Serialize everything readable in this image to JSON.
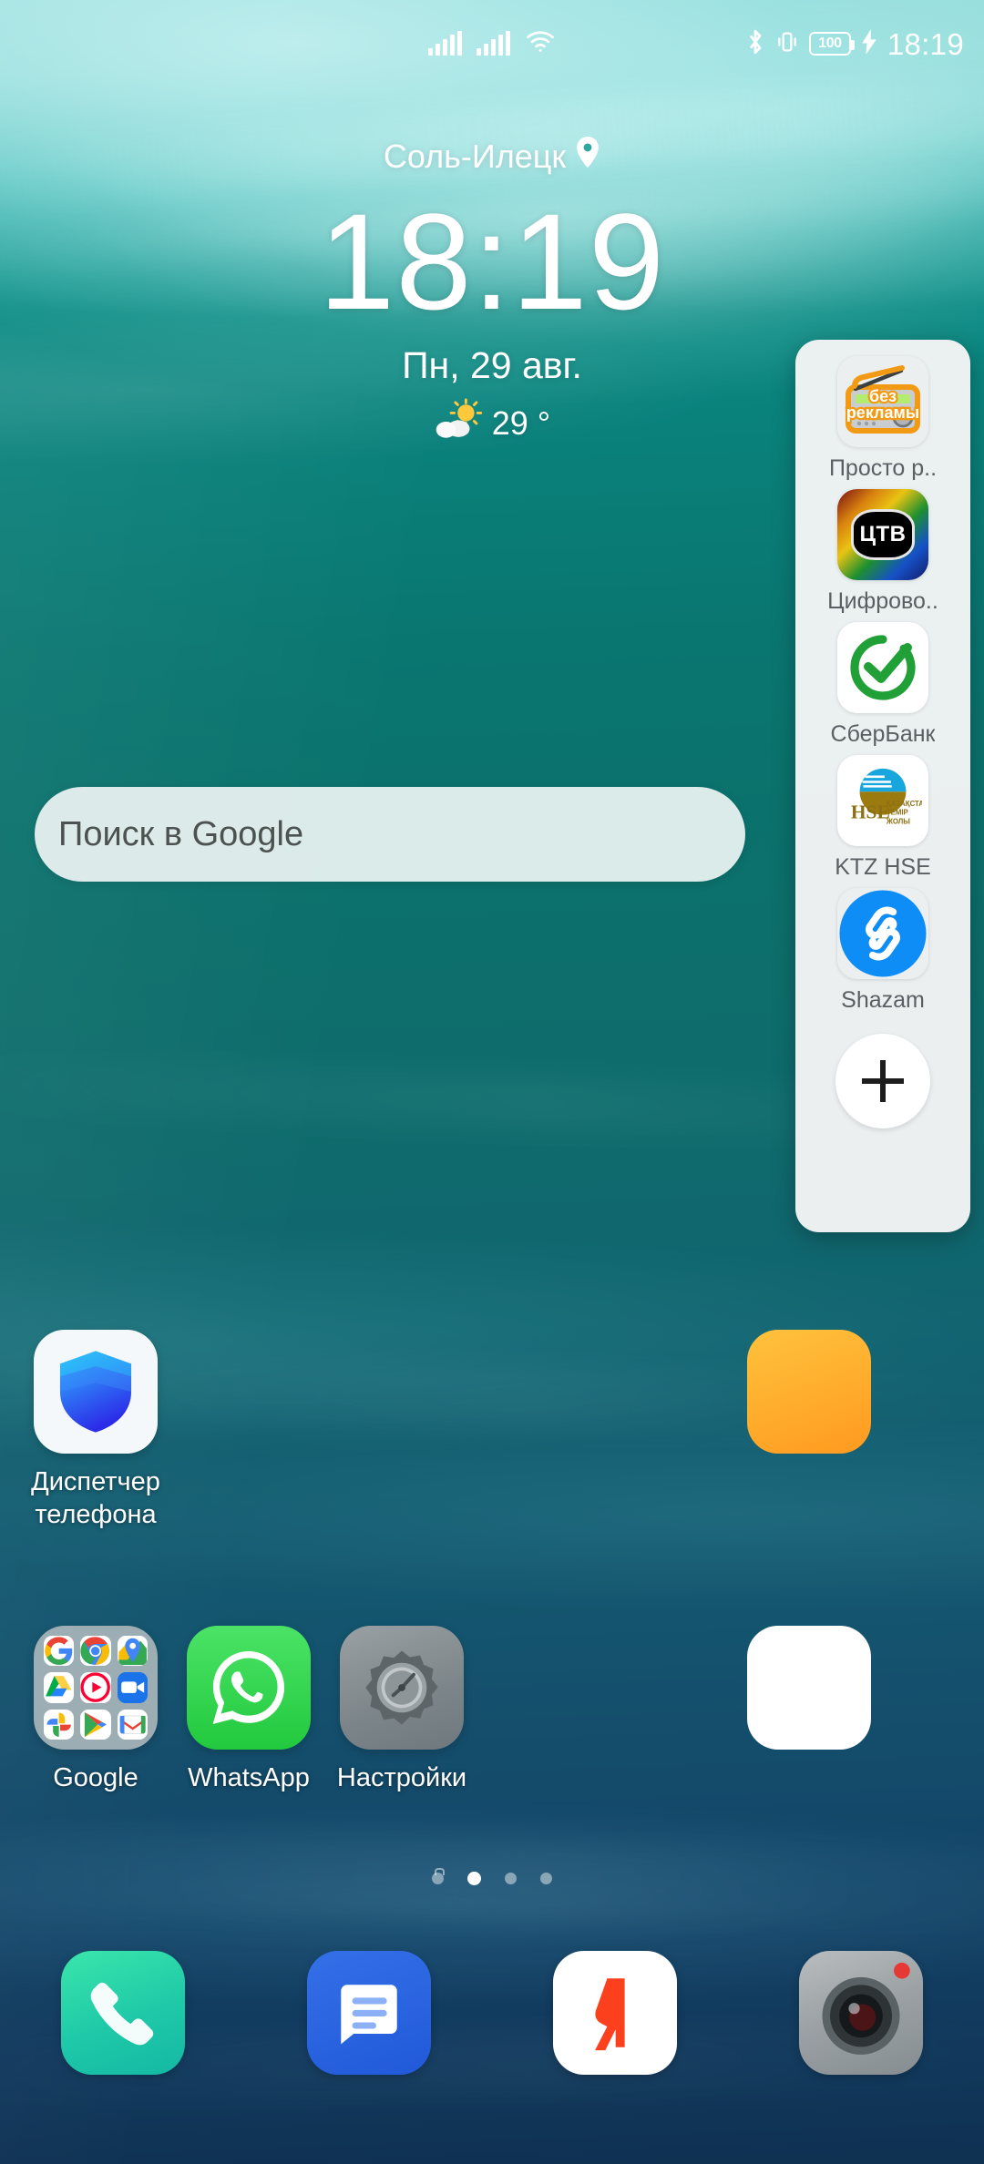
{
  "status_bar": {
    "time": "18:19",
    "battery_level": "100",
    "icons": [
      "signal-bars-sim1-icon",
      "signal-bars-sim2-icon",
      "wifi-icon",
      "bluetooth-icon",
      "vibrate-icon",
      "battery-icon",
      "charging-bolt-icon"
    ]
  },
  "clock_widget": {
    "location": "Соль-Илецк",
    "location_icon": "location-pin-icon",
    "time": "18:19",
    "date": "Пн, 29 авг.",
    "weather_icon": "partly-cloudy-icon",
    "temperature": "29 °"
  },
  "search": {
    "placeholder": "Поиск в Google"
  },
  "apps": [
    {
      "label": "Диспетчер\nтелефона",
      "icon": "phone-manager-shield-icon"
    },
    {
      "label": "Google",
      "icon": "google-folder-icon"
    },
    {
      "label": "WhatsApp",
      "icon": "whatsapp-icon"
    },
    {
      "label": "Настройки",
      "icon": "settings-gear-icon"
    }
  ],
  "google_folder_apps": [
    "google-search-icon",
    "chrome-icon",
    "maps-icon",
    "drive-icon",
    "youtube-music-icon",
    "meet-icon",
    "photos-icon",
    "play-store-icon",
    "gmail-icon"
  ],
  "page_indicator": {
    "pages": 4,
    "active_index": 1
  },
  "dock": [
    {
      "label": "Телефон",
      "icon": "phone-dialer-icon"
    },
    {
      "label": "Сообщения",
      "icon": "messages-icon"
    },
    {
      "label": "Яндекс",
      "icon": "yandex-icon"
    },
    {
      "label": "Камера",
      "icon": "camera-icon"
    }
  ],
  "sidebar": {
    "add_button_label": "+",
    "items": [
      {
        "label": "Просто р..",
        "icon": "radio-app-icon",
        "badge": "без рекламы"
      },
      {
        "label": "Цифрово..",
        "icon": "ctv-icon",
        "badge": "ЦТВ"
      },
      {
        "label": "СберБанк",
        "icon": "sberbank-icon"
      },
      {
        "label": "KTZ HSE",
        "icon": "ktz-hse-icon",
        "badge": "HSE"
      },
      {
        "label": "Shazam",
        "icon": "shazam-icon"
      }
    ]
  },
  "colors": {
    "wallpaper_top": "#9fdfdc",
    "wallpaper_mid": "#0b8a83",
    "wallpaper_bottom": "#0f3152",
    "sidebar_bg": "#f3f4f5",
    "search_bg": "#ecf4f3",
    "sber_green": "#21a038",
    "shazam_blue": "#0d8df5",
    "whatsapp_green": "#25d366",
    "yandex_red": "#fc3f1d"
  }
}
